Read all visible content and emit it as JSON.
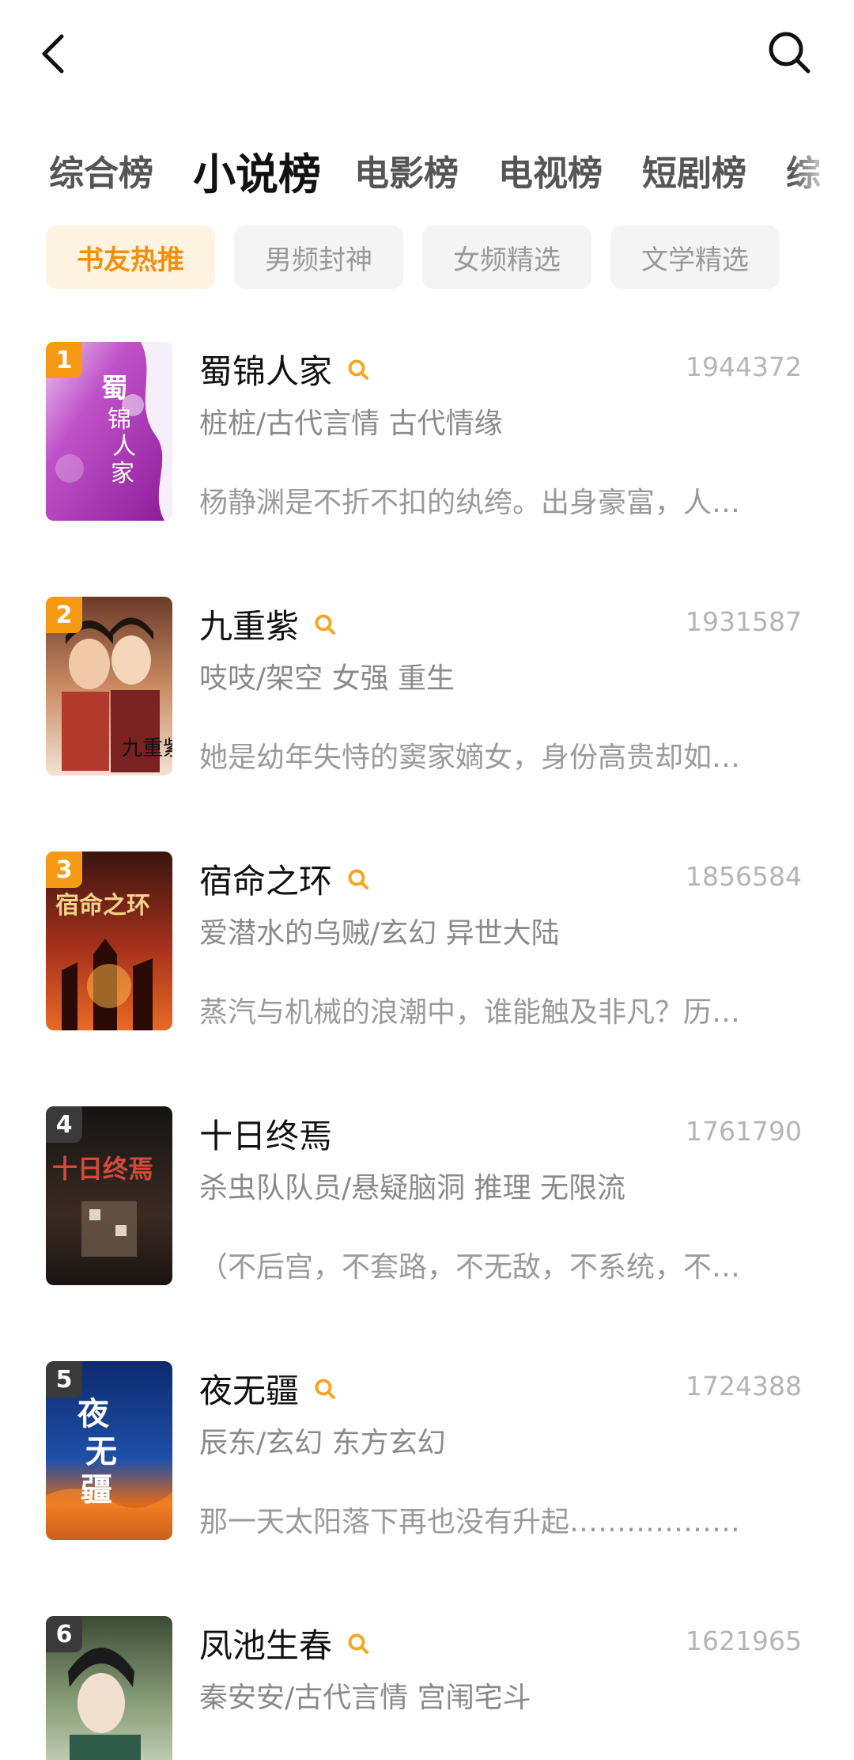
{
  "nav": {
    "back_icon": "chevron-left-icon",
    "search_icon": "search-icon"
  },
  "tabs": [
    {
      "label": "综合榜"
    },
    {
      "label": "小说榜"
    },
    {
      "label": "电影榜"
    },
    {
      "label": "电视榜"
    },
    {
      "label": "短剧榜"
    },
    {
      "label": "综"
    }
  ],
  "active_tab": "小说榜",
  "chips": [
    {
      "label": "书友热推"
    },
    {
      "label": "男频封神"
    },
    {
      "label": "女频精选"
    },
    {
      "label": "文学精选"
    }
  ],
  "active_chip": "书友热推",
  "colors": {
    "accent": "#f59a12",
    "chip_active_bg": "#fff3e2",
    "chip_active_text": "#f28f0c"
  },
  "books": [
    {
      "rank": "1",
      "title": "蜀锦人家",
      "count": "1944372",
      "meta": "桩桩/古代言情 古代情缘",
      "desc": "杨静渊是不折不扣的纨绔。出身豪富，人…",
      "has_search": true
    },
    {
      "rank": "2",
      "title": "九重紫",
      "count": "1931587",
      "meta": "吱吱/架空 女强 重生",
      "desc": "她是幼年失恃的窦家嫡女，身份高贵却如…",
      "has_search": true
    },
    {
      "rank": "3",
      "title": "宿命之环",
      "count": "1856584",
      "meta": "爱潜水的乌贼/玄幻 异世大陆",
      "desc": "蒸汽与机械的浪潮中，谁能触及非凡？历…",
      "has_search": true
    },
    {
      "rank": "4",
      "title": "十日终焉",
      "count": "1761790",
      "meta": "杀虫队队员/悬疑脑洞 推理 无限流",
      "desc": "（不后宫，不套路，不无敌，不系统，不…",
      "has_search": false
    },
    {
      "rank": "5",
      "title": "夜无疆",
      "count": "1724388",
      "meta": "辰东/玄幻 东方玄幻",
      "desc": "那一天太阳落下再也没有升起………………",
      "has_search": true
    },
    {
      "rank": "6",
      "title": "凤池生春",
      "count": "1621965",
      "meta": "秦安安/古代言情 宫闱宅斗",
      "desc": "",
      "has_search": true
    }
  ]
}
